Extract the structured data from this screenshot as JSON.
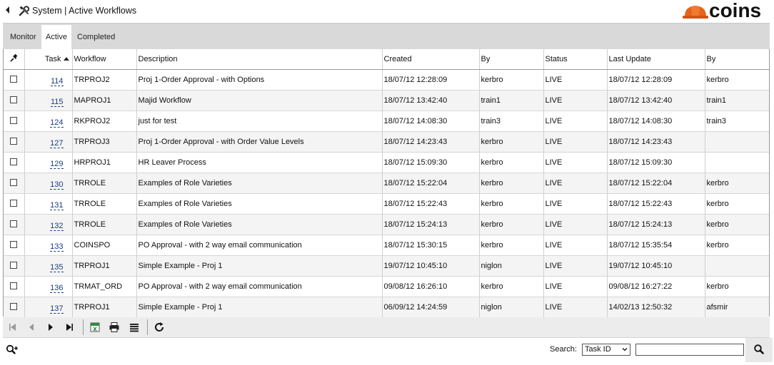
{
  "window": {
    "title": "System | Active Workflows",
    "logo_text": "coins",
    "logo_color": "#e8621a"
  },
  "tabs": [
    {
      "label": "Monitor",
      "active": false
    },
    {
      "label": "Active",
      "active": true
    },
    {
      "label": "Completed",
      "active": false
    }
  ],
  "table": {
    "columns": [
      "",
      "Task",
      "Workflow",
      "Description",
      "Created",
      "By",
      "Status",
      "Last Update",
      "By"
    ],
    "sort": {
      "column": "Task",
      "direction": "ascending"
    },
    "rows": [
      {
        "task": "114",
        "workflow": "TRPROJ2",
        "description": "Proj 1-Order Approval - with Options",
        "created": "18/07/12 12:28:09",
        "by": "kerbro",
        "status": "LIVE",
        "last_update": "18/07/12 12:28:09",
        "updated_by": "kerbro"
      },
      {
        "task": "115",
        "workflow": "MAPROJ1",
        "description": "Majid Workflow",
        "created": "18/07/12 13:42:40",
        "by": "train1",
        "status": "LIVE",
        "last_update": "18/07/12 13:42:40",
        "updated_by": "train1"
      },
      {
        "task": "124",
        "workflow": "RKPROJ2",
        "description": "just for test",
        "created": "18/07/12 14:08:30",
        "by": "train3",
        "status": "LIVE",
        "last_update": "18/07/12 14:08:30",
        "updated_by": "train3"
      },
      {
        "task": "127",
        "workflow": "TRPROJ3",
        "description": "Proj 1-Order Approval - with Order Value Levels",
        "created": "18/07/12 14:23:43",
        "by": "kerbro",
        "status": "LIVE",
        "last_update": "18/07/12 14:23:43",
        "updated_by": ""
      },
      {
        "task": "129",
        "workflow": "HRPROJ1",
        "description": "HR Leaver Process",
        "created": "18/07/12 15:09:30",
        "by": "kerbro",
        "status": "LIVE",
        "last_update": "18/07/12 15:09:30",
        "updated_by": ""
      },
      {
        "task": "130",
        "workflow": "TRROLE",
        "description": "Examples of Role Varieties",
        "created": "18/07/12 15:22:04",
        "by": "kerbro",
        "status": "LIVE",
        "last_update": "18/07/12 15:22:04",
        "updated_by": "kerbro"
      },
      {
        "task": "131",
        "workflow": "TRROLE",
        "description": "Examples of Role Varieties",
        "created": "18/07/12 15:22:43",
        "by": "kerbro",
        "status": "LIVE",
        "last_update": "18/07/12 15:22:43",
        "updated_by": "kerbro"
      },
      {
        "task": "132",
        "workflow": "TRROLE",
        "description": "Examples of Role Varieties",
        "created": "18/07/12 15:24:13",
        "by": "kerbro",
        "status": "LIVE",
        "last_update": "18/07/12 15:24:13",
        "updated_by": "kerbro"
      },
      {
        "task": "133",
        "workflow": "COINSPO",
        "description": "PO Approval - with 2 way email communication",
        "created": "18/07/12 15:30:15",
        "by": "kerbro",
        "status": "LIVE",
        "last_update": "18/07/12 15:35:54",
        "updated_by": "kerbro"
      },
      {
        "task": "135",
        "workflow": "TRPROJ1",
        "description": "Simple Example - Proj 1",
        "created": "19/07/12 10:45:10",
        "by": "niglon",
        "status": "LIVE",
        "last_update": "19/07/12 10:45:10",
        "updated_by": ""
      },
      {
        "task": "136",
        "workflow": "TRMAT_ORD",
        "description": "PO Approval - with 2 way email communication",
        "created": "09/08/12 16:26:10",
        "by": "kerbro",
        "status": "LIVE",
        "last_update": "09/08/12 16:27:22",
        "updated_by": "kerbro"
      },
      {
        "task": "137",
        "workflow": "TRPROJ1",
        "description": "Simple Example - Proj 1",
        "created": "06/09/12 14:24:59",
        "by": "niglon",
        "status": "LIVE",
        "last_update": "14/02/13 12:50:32",
        "updated_by": "afsmir"
      }
    ]
  },
  "toolbar": {
    "icons": [
      "first-page-icon",
      "previous-page-icon",
      "next-page-icon",
      "last-page-icon",
      "excel-export-icon",
      "print-icon",
      "list-view-icon",
      "refresh-icon"
    ]
  },
  "search": {
    "label": "Search:",
    "field_selected": "Task ID",
    "input_value": ""
  }
}
